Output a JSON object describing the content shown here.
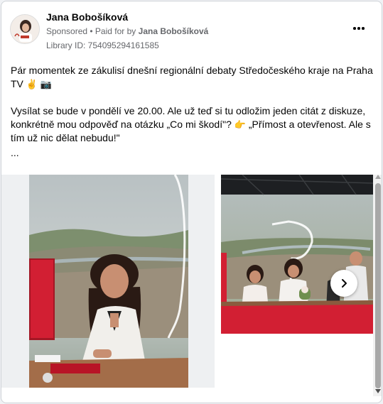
{
  "post": {
    "author": "Jana Bobošíková",
    "sponsored": "Sponsored",
    "paid_prefix": "• Paid for by",
    "paid_by": "Jana Bobošíková",
    "library_id": "Library ID: 754095294161585",
    "more_icon": "more-horizontal-icon",
    "text_p1": "Pár momentek ze zákulisí dnešní regionální debaty Středočeského kraje na Praha TV",
    "emoji_victory": "✌",
    "emoji_camera": "📷",
    "text_p2a": "Vysílat se bude v pondělí ve 20.00. Ale už teď si tu odložim jeden citát z diskuze, konkrétně mou odpověď na otázku „Co mi škodí\"?",
    "emoji_point": "👉",
    "text_p2b": "„Přímost a otevřenost. Ale s tím už nic dělat nebudu!\"",
    "ellipsis": "..."
  },
  "carousel": {
    "next_icon": "chevron-right-icon",
    "colors": {
      "red_desk": "#d7192f",
      "backdrop_sky": "#c9cfcf"
    }
  }
}
